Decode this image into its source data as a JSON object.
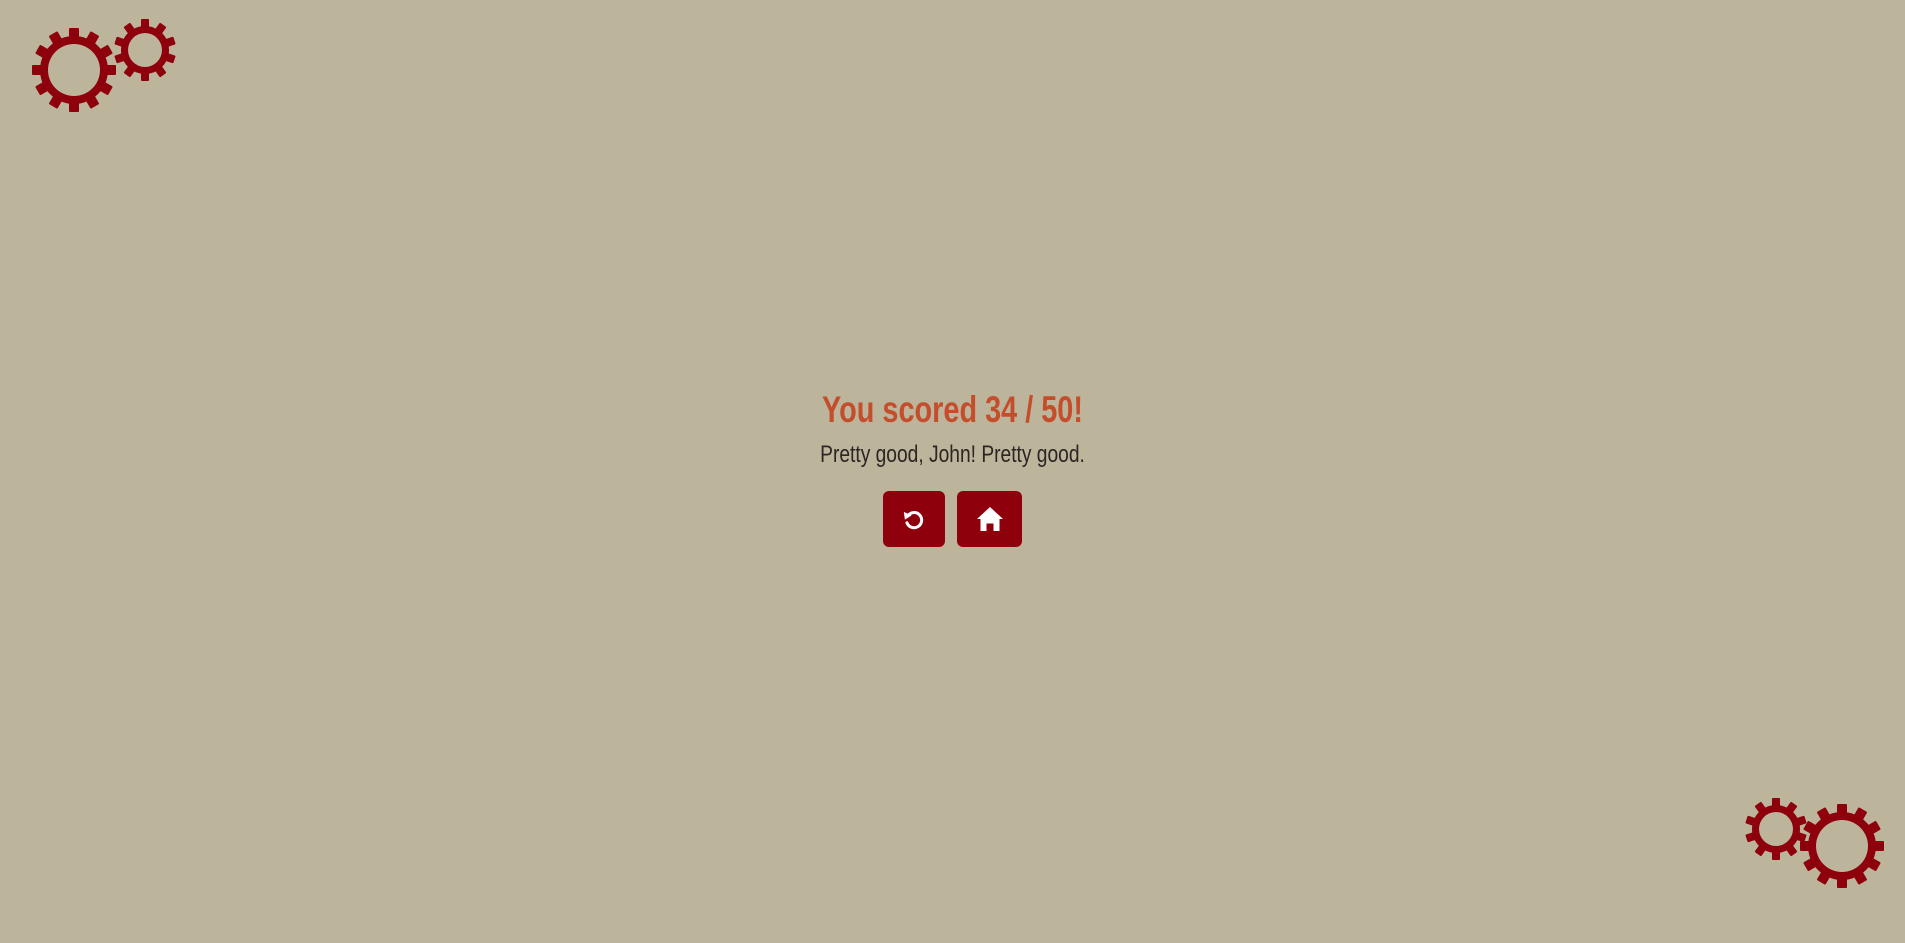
{
  "result": {
    "score_text": "You scored 34 / 50!",
    "message": "Pretty good, John! Pretty good."
  },
  "buttons": {
    "restart_icon": "restart-icon",
    "home_icon": "home-icon"
  },
  "decorations": {
    "icon": "gears-icon"
  },
  "colors": {
    "background": "#bdb49c",
    "accent": "#8e000b",
    "score": "#c44e2c",
    "text": "#2b2623"
  }
}
